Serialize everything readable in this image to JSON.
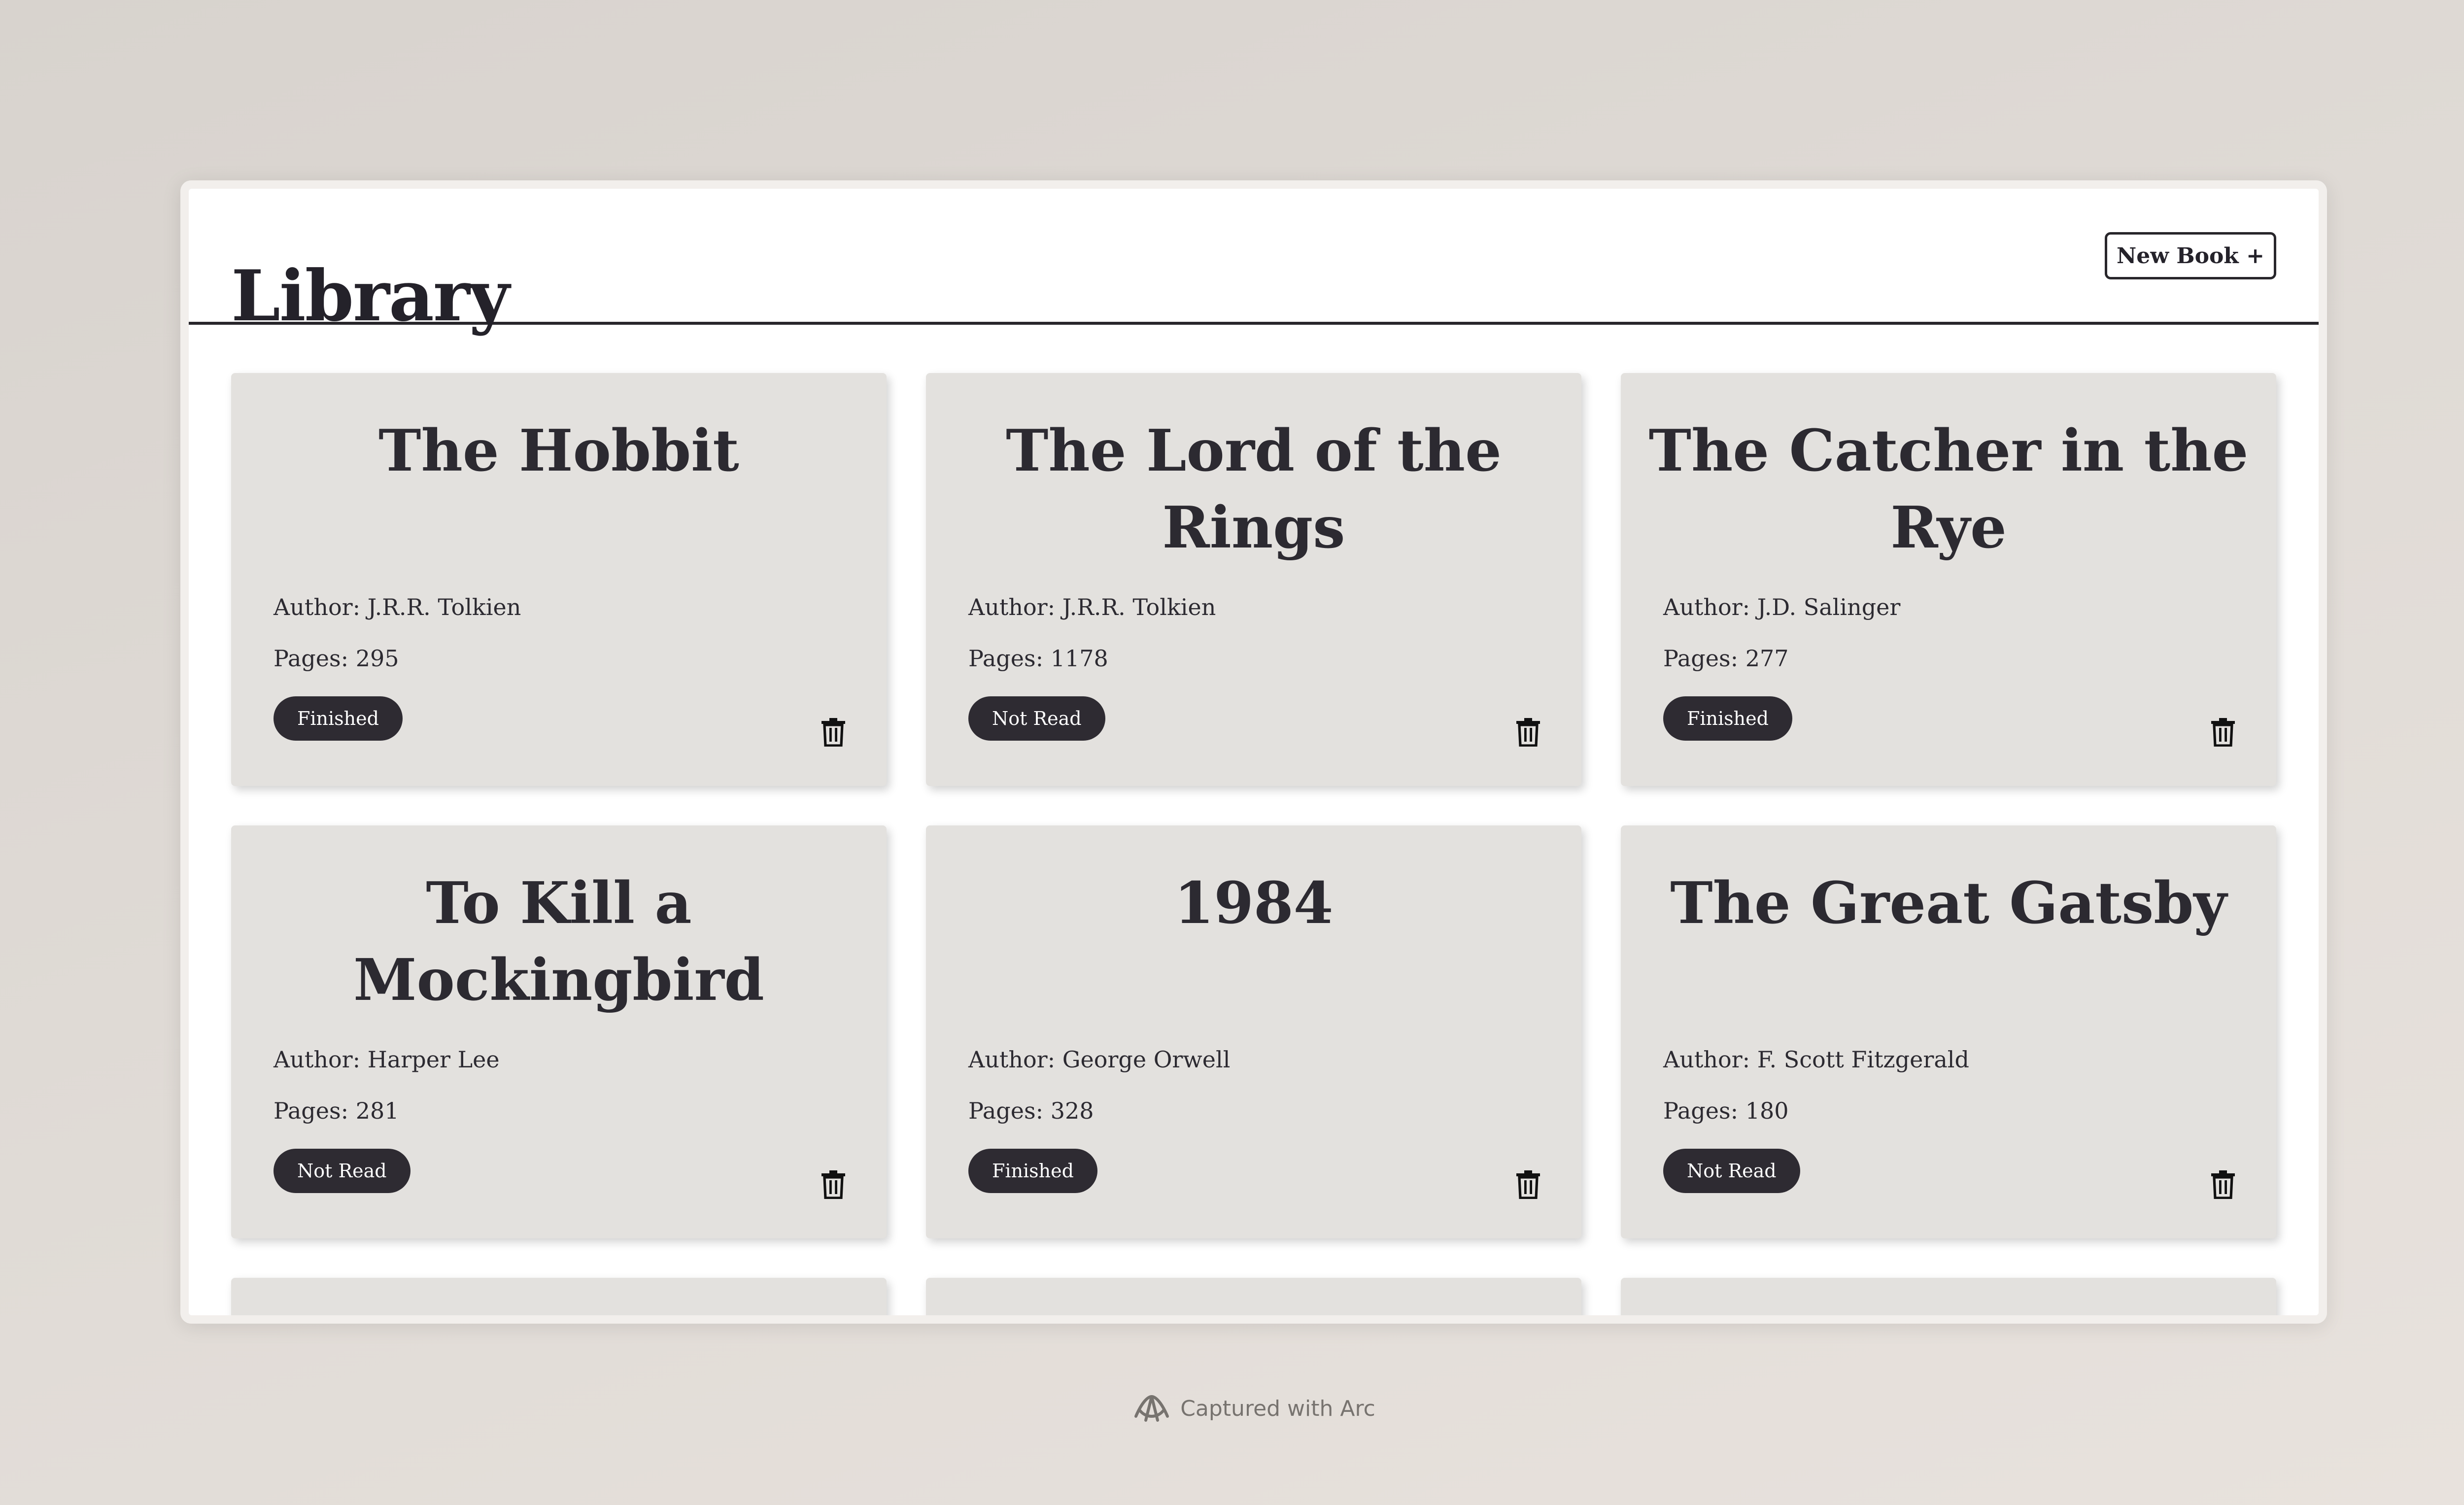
{
  "header": {
    "title": "Library",
    "new_book_label": "New Book +"
  },
  "books": [
    {
      "title": "The Hobbit",
      "author": "Author: J.R.R. Tolkien",
      "pages": "Pages: 295",
      "status": "Finished"
    },
    {
      "title": "The Lord of the Rings",
      "author": "Author: J.R.R. Tolkien",
      "pages": "Pages: 1178",
      "status": "Not Read"
    },
    {
      "title": "The Catcher in the Rye",
      "author": "Author: J.D. Salinger",
      "pages": "Pages: 277",
      "status": "Finished"
    },
    {
      "title": "To Kill a Mockingbird",
      "author": "Author: Harper Lee",
      "pages": "Pages: 281",
      "status": "Not Read"
    },
    {
      "title": "1984",
      "author": "Author: George Orwell",
      "pages": "Pages: 328",
      "status": "Finished"
    },
    {
      "title": "The Great Gatsby",
      "author": "Author: F. Scott Fitzgerald",
      "pages": "Pages: 180",
      "status": "Not Read"
    }
  ],
  "footer": {
    "label": "Captured with Arc",
    "icon": "arc-logo-icon"
  },
  "colors": {
    "background": "#ddd8d3",
    "card": "#e3e1de",
    "badge": "#2e2b32",
    "text": "#2c2a31"
  }
}
